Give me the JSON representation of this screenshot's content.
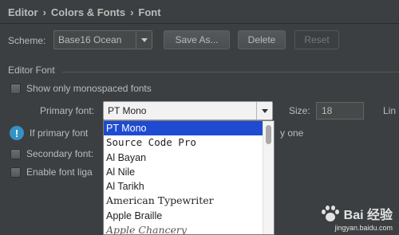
{
  "breadcrumb": {
    "items": [
      "Editor",
      "Colors & Fonts",
      "Font"
    ],
    "separator": "›"
  },
  "scheme": {
    "label": "Scheme:",
    "value": "Base16 Ocean",
    "buttons": {
      "save_as": "Save As...",
      "delete": "Delete",
      "reset": "Reset"
    }
  },
  "editor_font": {
    "group_label": "Editor Font",
    "show_monospaced": "Show only monospaced fonts",
    "primary_label": "Primary font:",
    "primary_value": "PT Mono",
    "size_label": "Size:",
    "size_value": "18",
    "line_spacing_partial": "Lin",
    "info_before": "If primary font",
    "info_after": "y one",
    "secondary_label": "Secondary font:",
    "ligatures_label": "Enable font liga"
  },
  "dropdown": {
    "items": [
      "PT Mono",
      "Source Code Pro",
      "Al Bayan",
      "Al Nile",
      "Al Tarikh",
      "American Typewriter",
      "Apple Braille",
      "Apple Chancery"
    ],
    "selected_index": 0
  },
  "watermark": {
    "brand": "Bai 经验",
    "url": "jingyan.baidu.com"
  },
  "colors": {
    "background": "#3c3f41",
    "text": "#bbbbbb",
    "selection": "#1e4bd2",
    "info_icon": "#3592c4"
  }
}
